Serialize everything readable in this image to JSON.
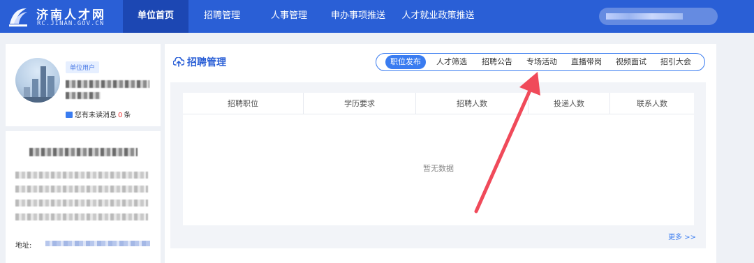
{
  "header": {
    "logo_title": "济南人才网",
    "logo_subtitle": "RC.JINAN.GOV.CN",
    "nav": [
      {
        "label": "单位首页",
        "active": true
      },
      {
        "label": "招聘管理",
        "active": false
      },
      {
        "label": "人事管理",
        "active": false
      },
      {
        "label": "申办事项推送",
        "active": false
      },
      {
        "label": "人才就业政策推送",
        "active": false
      }
    ]
  },
  "profile": {
    "badge": "单位用户",
    "unread_prefix": "您有未读消息",
    "unread_count": "0",
    "unread_suffix": "条"
  },
  "company": {
    "address_label": "地址:"
  },
  "recruitment": {
    "title": "招聘管理",
    "tabs": [
      {
        "label": "职位发布",
        "active": true
      },
      {
        "label": "人才筛选",
        "active": false
      },
      {
        "label": "招聘公告",
        "active": false
      },
      {
        "label": "专场活动",
        "active": false
      },
      {
        "label": "直播带岗",
        "active": false
      },
      {
        "label": "视频面试",
        "active": false
      },
      {
        "label": "招引大会",
        "active": false
      }
    ],
    "columns": [
      "招聘职位",
      "学历要求",
      "招聘人数",
      "投递人数",
      "联系人数"
    ],
    "empty_text": "暂无数据",
    "more_label": "更多 >>"
  },
  "colors": {
    "primary": "#2a5fd6",
    "accent": "#3a7cf0",
    "arrow": "#f04a5a"
  }
}
